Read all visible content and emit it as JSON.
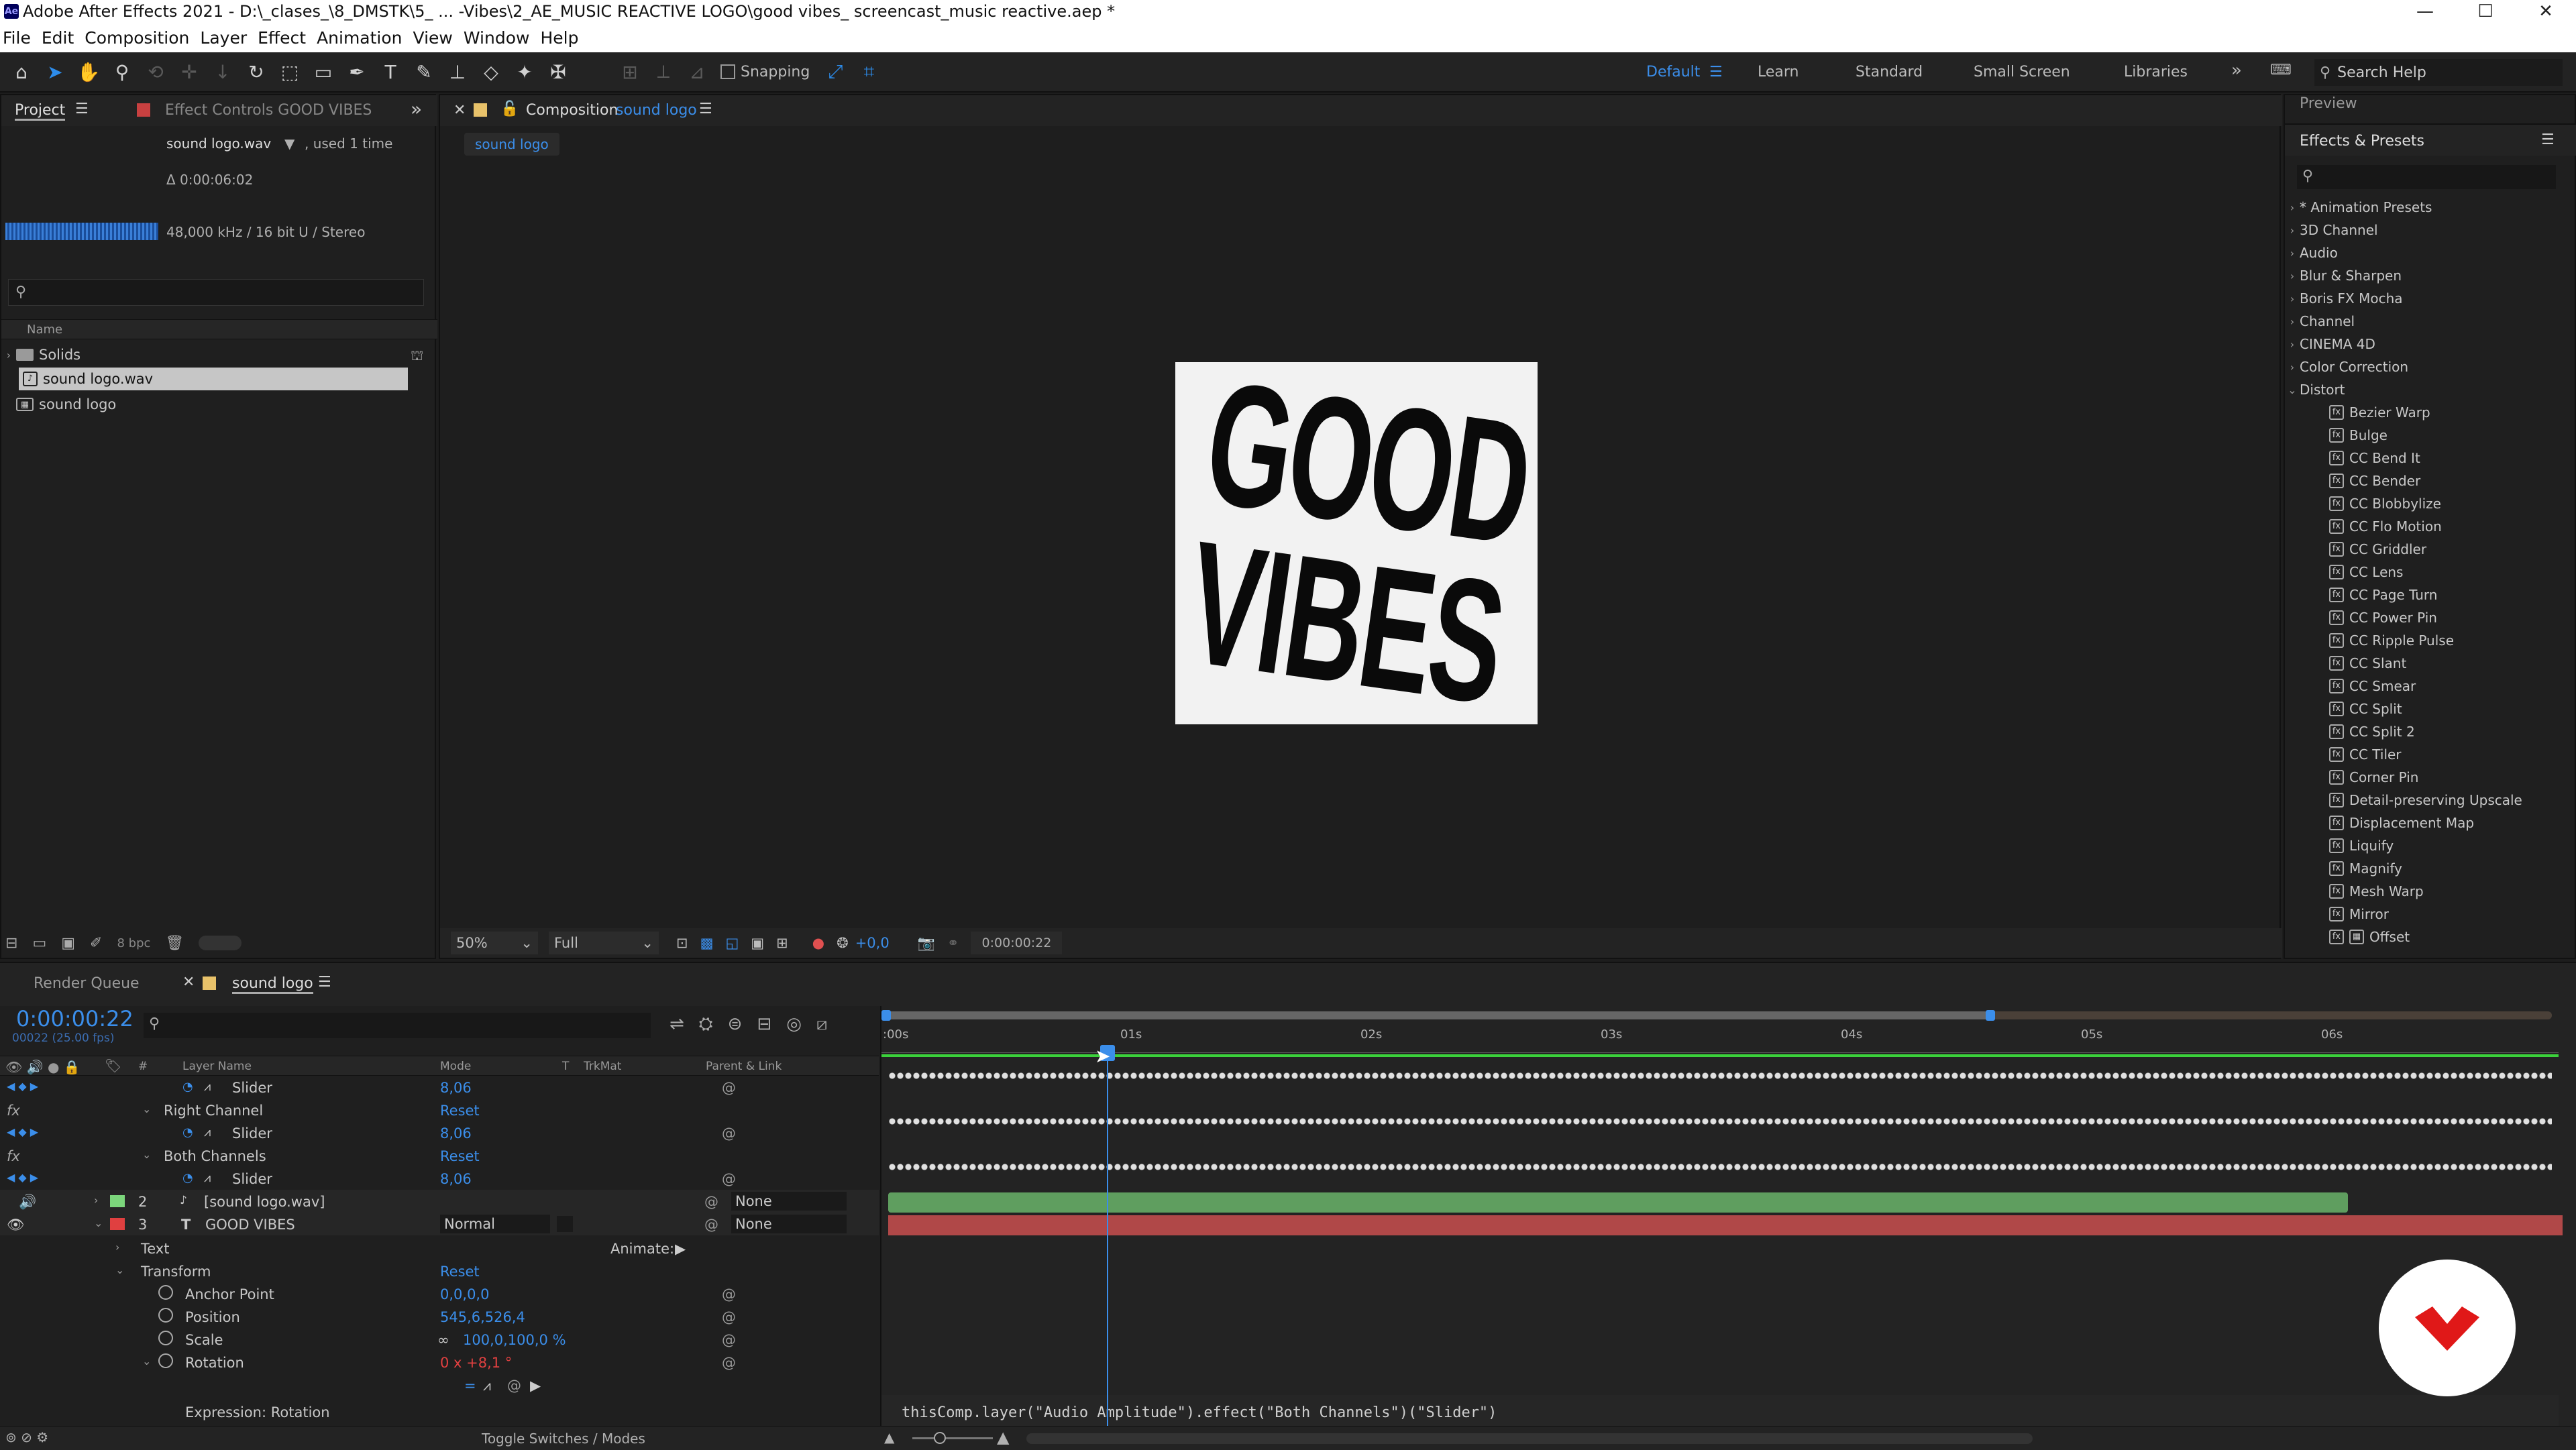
{
  "window": {
    "title": "Adobe After Effects 2021 - D:\\_clases_\\8_DMSTK\\5_ ... -Vibes\\2_AE_MUSIC REACTIVE LOGO\\good vibes_ screencast_music reactive.aep *",
    "app_badge": "Ae"
  },
  "menu": [
    "File",
    "Edit",
    "Composition",
    "Layer",
    "Effect",
    "Animation",
    "View",
    "Window",
    "Help"
  ],
  "toolbar": {
    "snapping_label": "Snapping",
    "workspaces": [
      "Default",
      "Learn",
      "Standard",
      "Small Screen",
      "Libraries"
    ],
    "search_placeholder": "Search Help"
  },
  "project_panel": {
    "tab_project": "Project",
    "tab_effect_controls": "Effect Controls GOOD VIBES",
    "selected_file": "sound logo.wav",
    "used": ", used 1 time",
    "duration": "Δ 0:00:06:02",
    "audio_info": "48,000 kHz / 16 bit U / Stereo",
    "col_name": "Name",
    "items": [
      "Solids",
      "sound logo.wav",
      "sound logo"
    ],
    "bpc": "8 bpc"
  },
  "composition_panel": {
    "tab_prefix": "Composition",
    "tab_name": "sound logo",
    "subtab": "sound logo",
    "logo_line1": "GOOD",
    "logo_line2": "VIBES",
    "zoom": "50%",
    "resolution": "Full",
    "exposure": "+0,0",
    "timecode": "0:00:00:22"
  },
  "effects_panel": {
    "preview_label": "Preview",
    "title": "Effects & Presets",
    "categories": [
      "* Animation Presets",
      "3D Channel",
      "Audio",
      "Blur & Sharpen",
      "Boris FX Mocha",
      "Channel",
      "CINEMA 4D",
      "Color Correction",
      "Distort"
    ],
    "distort_items": [
      "Bezier Warp",
      "Bulge",
      "CC Bend It",
      "CC Bender",
      "CC Blobbylize",
      "CC Flo Motion",
      "CC Griddler",
      "CC Lens",
      "CC Page Turn",
      "CC Power Pin",
      "CC Ripple Pulse",
      "CC Slant",
      "CC Smear",
      "CC Split",
      "CC Split 2",
      "CC Tiler",
      "Corner Pin",
      "Detail-preserving Upscale",
      "Displacement Map",
      "Liquify",
      "Magnify",
      "Mesh Warp",
      "Mirror",
      "Offset"
    ]
  },
  "timeline": {
    "tab_render": "Render Queue",
    "tab_comp": "sound logo",
    "current_time": "0:00:00:22",
    "frame_info": "00022 (25.00 fps)",
    "col_layer_name": "Layer Name",
    "col_mode": "Mode",
    "col_t": "T",
    "col_trkmat": "TrkMat",
    "col_parent": "Parent & Link",
    "rows": {
      "slider1_label": "Slider",
      "slider1_val": "8,06",
      "right_channel": "Right Channel",
      "reset1": "Reset",
      "slider2_label": "Slider",
      "slider2_val": "8,06",
      "both_channels": "Both Channels",
      "reset2": "Reset",
      "slider3_label": "Slider",
      "slider3_val": "8,06",
      "layer2_num": "2",
      "layer2_name": "[sound logo.wav]",
      "layer2_parent": "None",
      "layer3_num": "3",
      "layer3_name": "GOOD VIBES",
      "layer3_mode": "Normal",
      "layer3_parent": "None",
      "text_label": "Text",
      "animate_label": "Animate:",
      "transform_label": "Transform",
      "reset3": "Reset",
      "anchor_label": "Anchor Point",
      "anchor_val": "0,0,0,0",
      "position_label": "Position",
      "position_val": "545,6,526,4",
      "scale_label": "Scale",
      "scale_val": "100,0,100,0 %",
      "rotation_label": "Rotation",
      "rotation_val": "0 x +8,1 °",
      "expression_label": "Expression: Rotation"
    },
    "ruler": [
      ":00s",
      "01s",
      "02s",
      "03s",
      "04s",
      "05s",
      "06s"
    ],
    "expression_text": "thisComp.layer(\"Audio Amplitude\").effect(\"Both Channels\")(\"Slider\")",
    "footer": "Toggle Switches / Modes"
  },
  "colors": {
    "accent": "#2d8ceb",
    "audio_bar": "#5f9e5f",
    "text_bar": "#b04848",
    "audio_label": "#7cd67c",
    "text_label": "#e04040",
    "watermark": "#e01818"
  }
}
